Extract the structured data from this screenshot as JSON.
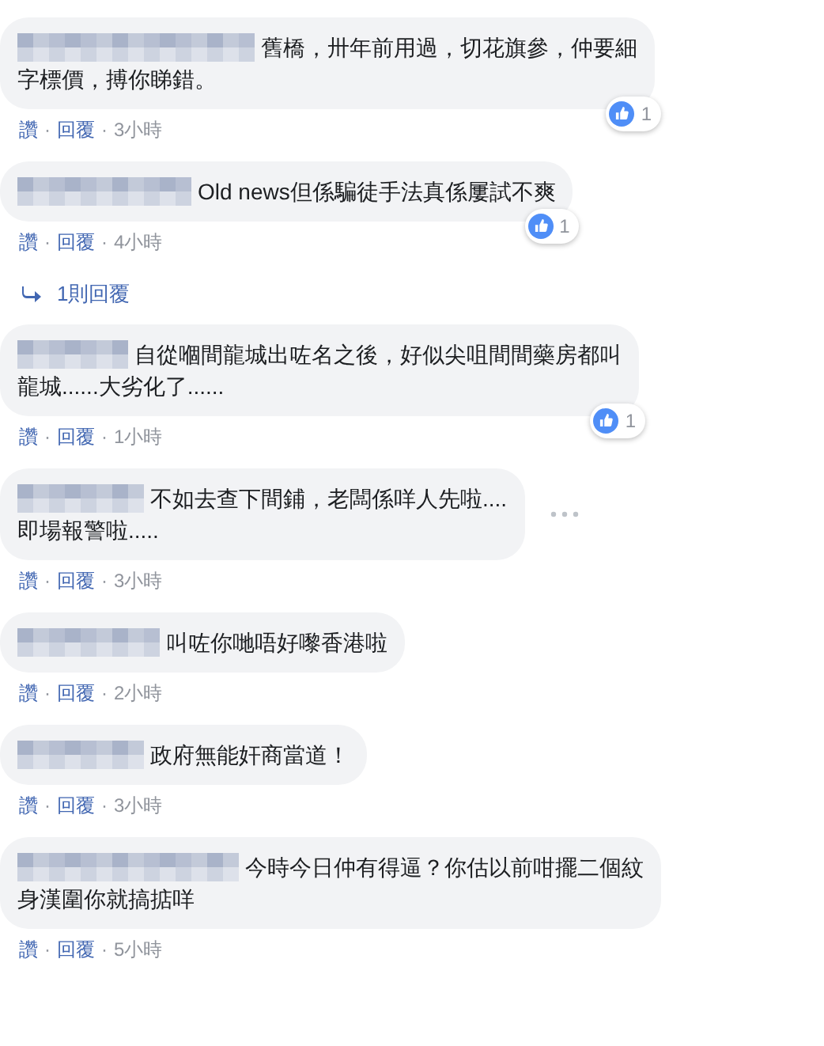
{
  "separator": "·",
  "comments": [
    {
      "lines": [
        "舊橋，卅年前用過，切花旗參，仲要細",
        "字標價，搏你睇錯。"
      ],
      "like": "讚",
      "reply": "回覆",
      "time": "3小時",
      "reactions": "1",
      "more": false
    },
    {
      "lines": [
        "Old news但係騙徒手法真係屢試不爽"
      ],
      "like": "讚",
      "reply": "回覆",
      "time": "4小時",
      "reactions": "1",
      "more": false,
      "replies": "1則回覆"
    },
    {
      "lines": [
        "自從嗰間龍城出咗名之後，好似尖咀間間藥房都叫",
        "龍城......大劣化了......"
      ],
      "like": "讚",
      "reply": "回覆",
      "time": "1小時",
      "reactions": "1",
      "more": false
    },
    {
      "lines": [
        "不如去查下間鋪，老闆係咩人先啦....",
        "即場報警啦....."
      ],
      "like": "讚",
      "reply": "回覆",
      "time": "3小時",
      "more": true
    },
    {
      "lines": [
        "叫咗你哋唔好嚟香港啦"
      ],
      "like": "讚",
      "reply": "回覆",
      "time": "2小時",
      "more": false
    },
    {
      "lines": [
        "政府無能奸商當道！"
      ],
      "like": "讚",
      "reply": "回覆",
      "time": "3小時",
      "more": false
    },
    {
      "lines": [
        "今時今日仲有得逼？你估以前咁擺二個紋",
        "身漢圍你就搞掂咩"
      ],
      "like": "讚",
      "reply": "回覆",
      "time": "5小時",
      "more": false
    }
  ]
}
